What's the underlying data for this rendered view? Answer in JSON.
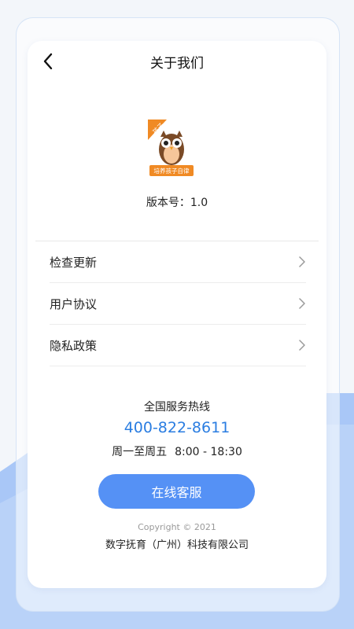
{
  "header": {
    "title": "关于我们"
  },
  "app": {
    "logo_badge": "孩子",
    "logo_tagline": "培养孩子自律",
    "version_label": "版本号：",
    "version": "1.0"
  },
  "menu": [
    {
      "label": "检查更新"
    },
    {
      "label": "用户协议"
    },
    {
      "label": "隐私政策"
    }
  ],
  "contact": {
    "hotline_title": "全国服务热线",
    "phone": "400-822-8611",
    "days": "周一至周五",
    "time": "8:00 - 18:30",
    "service_button": "在线客服"
  },
  "footer": {
    "copyright": "Copyright © 2021",
    "company": "数字抚育（广州）科技有限公司"
  },
  "colors": {
    "accent": "#5591f5",
    "phone": "#2a7de1",
    "logo_orange": "#f08a24",
    "background_wave": "#a9c7f7"
  }
}
